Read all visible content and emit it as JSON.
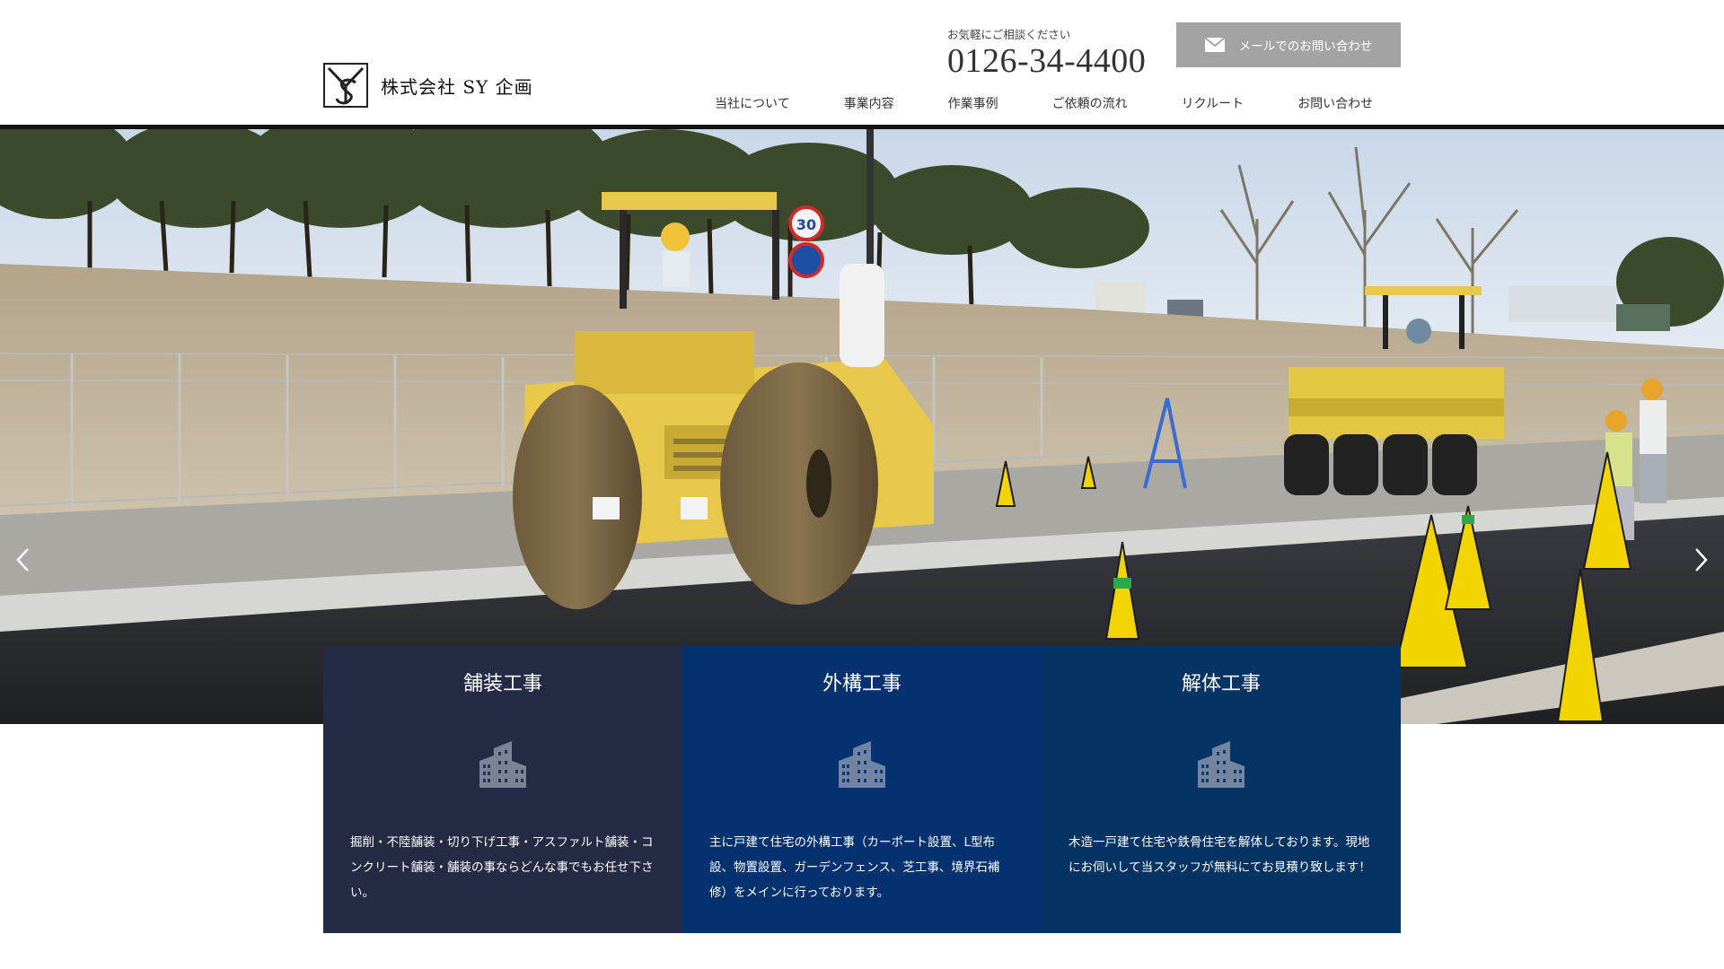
{
  "header": {
    "company_name": "株式会社 SY 企画",
    "contact_note": "お気軽にご相談ください",
    "phone": "0126-34-4400",
    "mail_button_label": "メールでのお問い合わせ",
    "nav": [
      "当社について",
      "事業内容",
      "作業事例",
      "ご依頼の流れ",
      "リクルート",
      "お問い合わせ"
    ]
  },
  "hero": {
    "sign_speed": "30"
  },
  "cards": [
    {
      "title": "舗装工事",
      "text": "掘削・不陸舗装・切り下げ工事・アスファルト舗装・コンクリート舗装・舗装の事ならどんな事でもお任せ下さい。",
      "bg": "#252a45"
    },
    {
      "title": "外構工事",
      "text": "主に戸建て住宅の外構工事（カーポート設置、L型布設、物置設置、ガーデンフェンス、芝工事、境界石補修）をメインに行っております。",
      "bg": "#043170"
    },
    {
      "title": "解体工事",
      "text": "木造一戸建て住宅や鉄骨住宅を解体しております。現地にお伺いして当スタッフが無料にてお見積り致します！",
      "bg": "#053364"
    }
  ],
  "icons": {
    "logo": "sy-logo-icon",
    "mail": "mail-envelope-icon",
    "card": "building-icon",
    "slider_prev": "chevron-left-icon",
    "slider_next": "chevron-right-icon"
  }
}
